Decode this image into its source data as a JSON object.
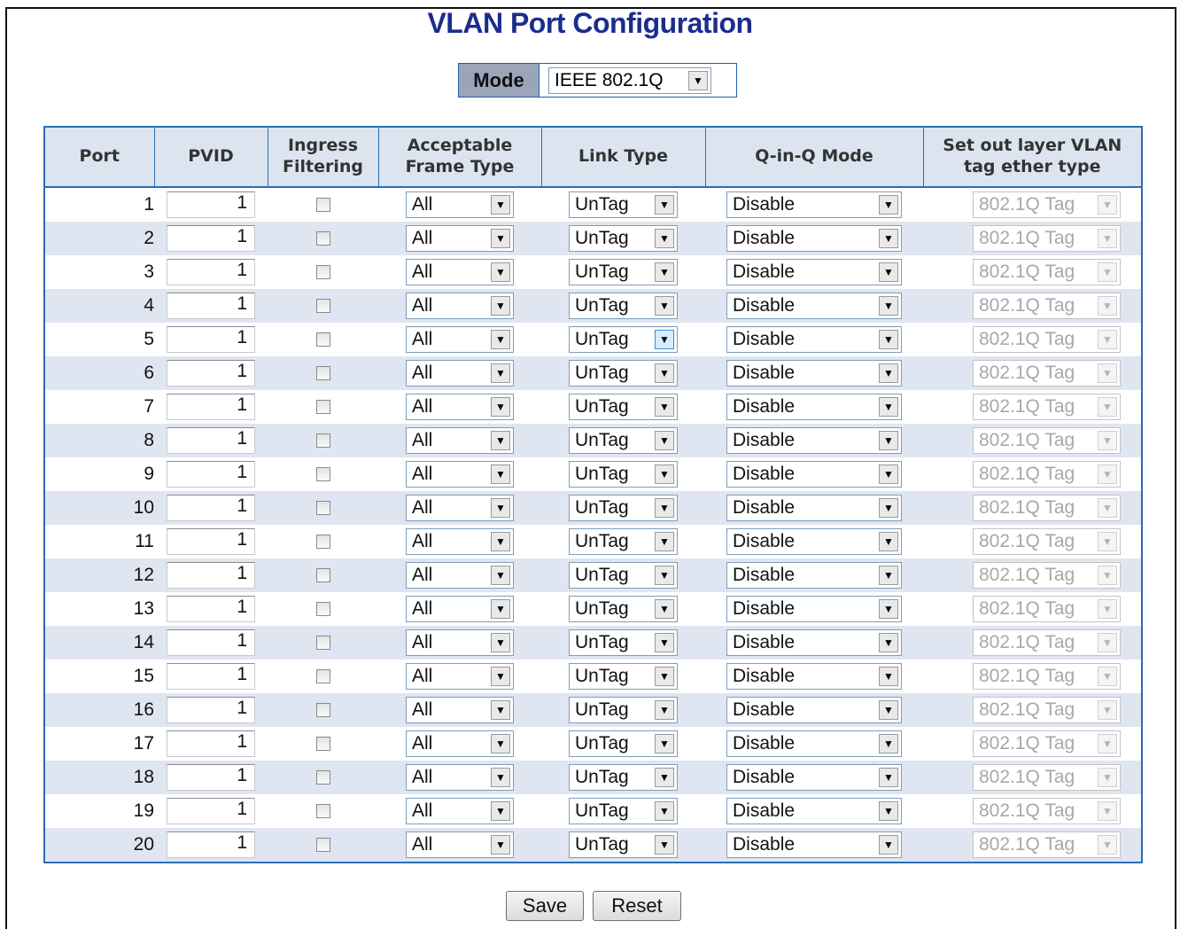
{
  "title": "VLAN Port Configuration",
  "mode": {
    "label": "Mode",
    "value": "IEEE 802.1Q"
  },
  "columns": [
    "Port",
    "PVID",
    "Ingress Filtering",
    "Acceptable Frame Type",
    "Link Type",
    "Q-in-Q Mode",
    "Set out layer VLAN tag ether type"
  ],
  "rows": [
    {
      "port": "1",
      "pvid": "1",
      "frame_type": "All",
      "link_type": "UnTag",
      "qinq_mode": "Disable",
      "ether_type": "802.1Q Tag"
    },
    {
      "port": "2",
      "pvid": "1",
      "frame_type": "All",
      "link_type": "UnTag",
      "qinq_mode": "Disable",
      "ether_type": "802.1Q Tag"
    },
    {
      "port": "3",
      "pvid": "1",
      "frame_type": "All",
      "link_type": "UnTag",
      "qinq_mode": "Disable",
      "ether_type": "802.1Q Tag"
    },
    {
      "port": "4",
      "pvid": "1",
      "frame_type": "All",
      "link_type": "UnTag",
      "qinq_mode": "Disable",
      "ether_type": "802.1Q Tag"
    },
    {
      "port": "5",
      "pvid": "1",
      "frame_type": "All",
      "link_type": "UnTag",
      "qinq_mode": "Disable",
      "ether_type": "802.1Q Tag"
    },
    {
      "port": "6",
      "pvid": "1",
      "frame_type": "All",
      "link_type": "UnTag",
      "qinq_mode": "Disable",
      "ether_type": "802.1Q Tag"
    },
    {
      "port": "7",
      "pvid": "1",
      "frame_type": "All",
      "link_type": "UnTag",
      "qinq_mode": "Disable",
      "ether_type": "802.1Q Tag"
    },
    {
      "port": "8",
      "pvid": "1",
      "frame_type": "All",
      "link_type": "UnTag",
      "qinq_mode": "Disable",
      "ether_type": "802.1Q Tag"
    },
    {
      "port": "9",
      "pvid": "1",
      "frame_type": "All",
      "link_type": "UnTag",
      "qinq_mode": "Disable",
      "ether_type": "802.1Q Tag"
    },
    {
      "port": "10",
      "pvid": "1",
      "frame_type": "All",
      "link_type": "UnTag",
      "qinq_mode": "Disable",
      "ether_type": "802.1Q Tag"
    },
    {
      "port": "11",
      "pvid": "1",
      "frame_type": "All",
      "link_type": "UnTag",
      "qinq_mode": "Disable",
      "ether_type": "802.1Q Tag"
    },
    {
      "port": "12",
      "pvid": "1",
      "frame_type": "All",
      "link_type": "UnTag",
      "qinq_mode": "Disable",
      "ether_type": "802.1Q Tag"
    },
    {
      "port": "13",
      "pvid": "1",
      "frame_type": "All",
      "link_type": "UnTag",
      "qinq_mode": "Disable",
      "ether_type": "802.1Q Tag"
    },
    {
      "port": "14",
      "pvid": "1",
      "frame_type": "All",
      "link_type": "UnTag",
      "qinq_mode": "Disable",
      "ether_type": "802.1Q Tag"
    },
    {
      "port": "15",
      "pvid": "1",
      "frame_type": "All",
      "link_type": "UnTag",
      "qinq_mode": "Disable",
      "ether_type": "802.1Q Tag"
    },
    {
      "port": "16",
      "pvid": "1",
      "frame_type": "All",
      "link_type": "UnTag",
      "qinq_mode": "Disable",
      "ether_type": "802.1Q Tag"
    },
    {
      "port": "17",
      "pvid": "1",
      "frame_type": "All",
      "link_type": "UnTag",
      "qinq_mode": "Disable",
      "ether_type": "802.1Q Tag"
    },
    {
      "port": "18",
      "pvid": "1",
      "frame_type": "All",
      "link_type": "UnTag",
      "qinq_mode": "Disable",
      "ether_type": "802.1Q Tag"
    },
    {
      "port": "19",
      "pvid": "1",
      "frame_type": "All",
      "link_type": "UnTag",
      "qinq_mode": "Disable",
      "ether_type": "802.1Q Tag"
    },
    {
      "port": "20",
      "pvid": "1",
      "frame_type": "All",
      "link_type": "UnTag",
      "qinq_mode": "Disable",
      "ether_type": "802.1Q Tag"
    }
  ],
  "buttons": {
    "save": "Save",
    "reset": "Reset"
  },
  "icons": {
    "dropdown": "chevron-down-icon"
  },
  "colors": {
    "title": "#1a2d8f",
    "header_bg": "#dce4f0",
    "alt_row_bg": "#dfe6f1",
    "border": "#2a6db5",
    "mode_label_bg": "#9aa6b8"
  }
}
